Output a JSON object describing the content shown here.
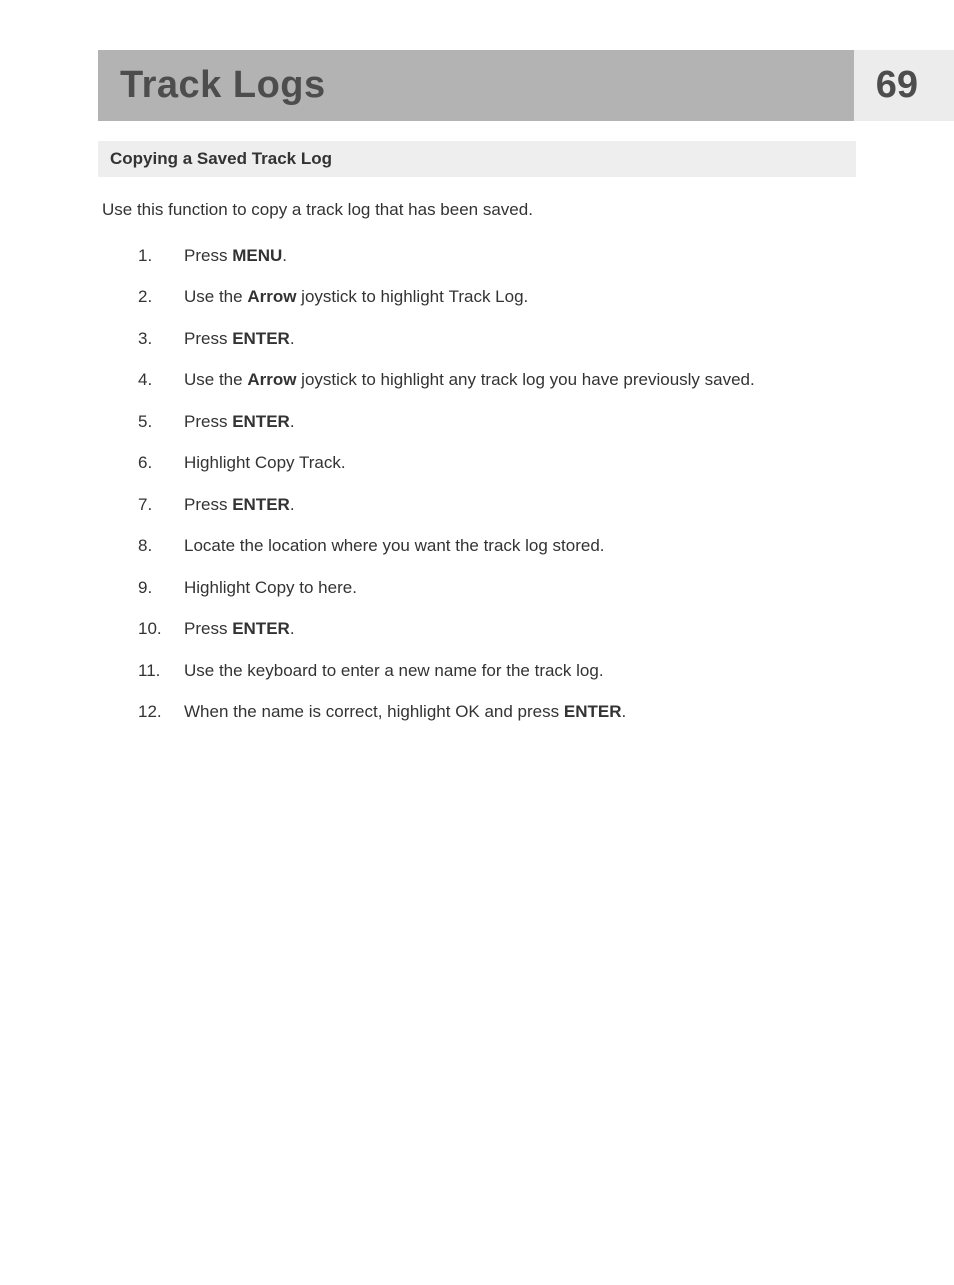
{
  "header": {
    "title": "Track Logs",
    "page_number": "69"
  },
  "section": {
    "heading": "Copying a Saved Track Log",
    "intro": "Use this function to copy a track log that has been saved."
  },
  "steps": [
    {
      "num": "1.",
      "parts": [
        {
          "t": "Press ",
          "c": ""
        },
        {
          "t": "MENU",
          "c": "bold"
        },
        {
          "t": ".",
          "c": ""
        }
      ]
    },
    {
      "num": "2.",
      "parts": [
        {
          "t": "Use the ",
          "c": ""
        },
        {
          "t": "Arrow",
          "c": "bold"
        },
        {
          "t": " joystick to highlight ",
          "c": ""
        },
        {
          "t": "Track Log",
          "c": "ui-label"
        },
        {
          "t": ".",
          "c": ""
        }
      ]
    },
    {
      "num": "3.",
      "parts": [
        {
          "t": "Press ",
          "c": ""
        },
        {
          "t": "ENTER",
          "c": "bold"
        },
        {
          "t": ".",
          "c": ""
        }
      ]
    },
    {
      "num": "4.",
      "parts": [
        {
          "t": "Use the ",
          "c": ""
        },
        {
          "t": "Arrow",
          "c": "bold"
        },
        {
          "t": " joystick to highlight any track log you have previously saved.",
          "c": ""
        }
      ]
    },
    {
      "num": "5.",
      "parts": [
        {
          "t": "Press ",
          "c": ""
        },
        {
          "t": "ENTER",
          "c": "bold"
        },
        {
          "t": ".",
          "c": ""
        }
      ]
    },
    {
      "num": "6.",
      "parts": [
        {
          "t": "Highlight ",
          "c": ""
        },
        {
          "t": "Copy Track",
          "c": "ui-label"
        },
        {
          "t": ".",
          "c": ""
        }
      ]
    },
    {
      "num": "7.",
      "parts": [
        {
          "t": "Press ",
          "c": ""
        },
        {
          "t": "ENTER",
          "c": "bold"
        },
        {
          "t": ".",
          "c": ""
        }
      ]
    },
    {
      "num": "8.",
      "parts": [
        {
          "t": "Locate the location where you want the track log stored.",
          "c": ""
        }
      ]
    },
    {
      "num": "9.",
      "parts": [
        {
          "t": "Highlight ",
          "c": ""
        },
        {
          "t": "Copy to here",
          "c": "ui-label"
        },
        {
          "t": ".",
          "c": ""
        }
      ]
    },
    {
      "num": "10.",
      "parts": [
        {
          "t": "Press ",
          "c": ""
        },
        {
          "t": "ENTER",
          "c": "bold"
        },
        {
          "t": ".",
          "c": ""
        }
      ]
    },
    {
      "num": "11.",
      "parts": [
        {
          "t": "Use the keyboard to enter a new name for the track log.",
          "c": ""
        }
      ]
    },
    {
      "num": "12.",
      "parts": [
        {
          "t": "When the name is correct, highlight ",
          "c": ""
        },
        {
          "t": "OK",
          "c": "ui-label"
        },
        {
          "t": " and press ",
          "c": ""
        },
        {
          "t": "ENTER",
          "c": "bold"
        },
        {
          "t": ".",
          "c": ""
        }
      ]
    }
  ]
}
